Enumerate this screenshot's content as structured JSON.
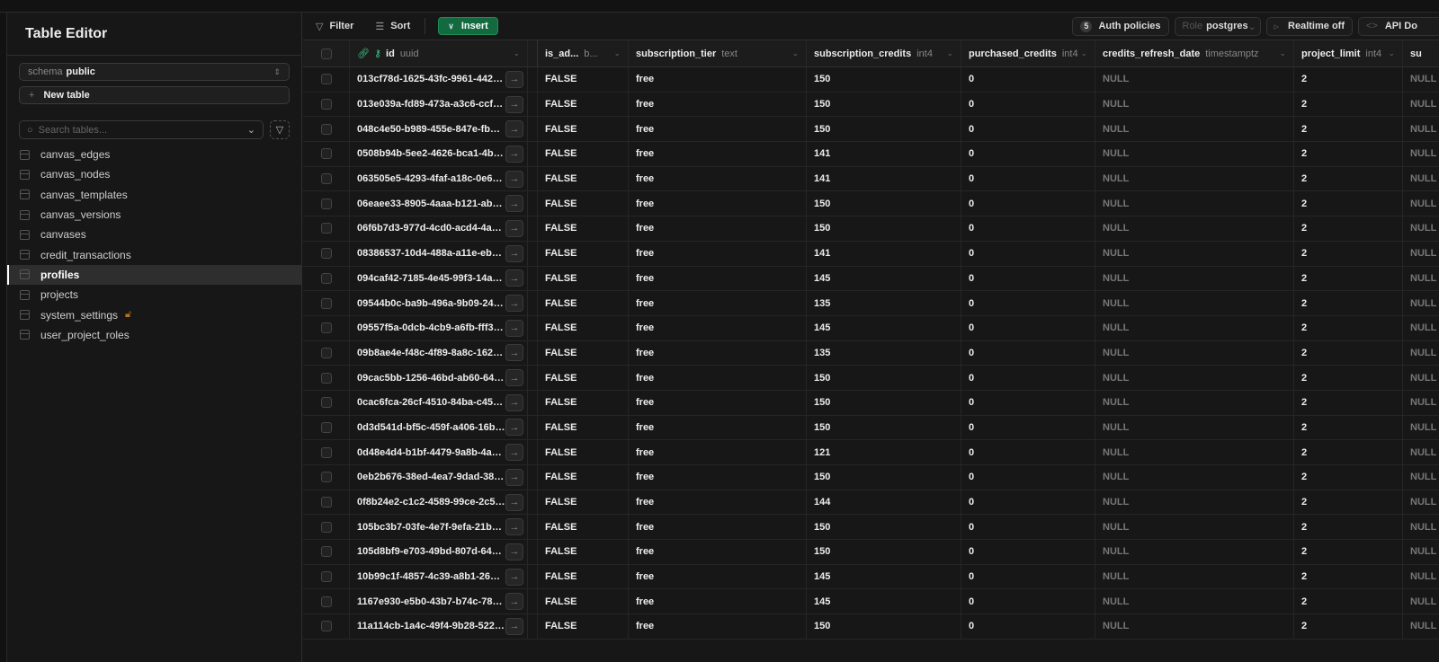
{
  "sidebar": {
    "title": "Table Editor",
    "schema_label": "schema",
    "schema_value": "public",
    "new_table": "New table",
    "search_placeholder": "Search tables...",
    "tables": [
      {
        "name": "canvas_edges"
      },
      {
        "name": "canvas_nodes"
      },
      {
        "name": "canvas_templates"
      },
      {
        "name": "canvas_versions"
      },
      {
        "name": "canvases"
      },
      {
        "name": "credit_transactions"
      },
      {
        "name": "profiles",
        "active": true
      },
      {
        "name": "projects"
      },
      {
        "name": "system_settings",
        "locked": true
      },
      {
        "name": "user_project_roles"
      }
    ]
  },
  "toolbar": {
    "filter": "Filter",
    "sort": "Sort",
    "insert": "Insert",
    "auth_count": "5",
    "auth_policies": "Auth policies",
    "role_label": "Role",
    "role_value": "postgres",
    "realtime": "Realtime off",
    "api_docs": "API Do"
  },
  "colors": {
    "accent": "#3ecf8e",
    "insert_bg": "#126a3e",
    "lock": "#b5731d"
  },
  "columns": [
    {
      "name": "id",
      "type": "uuid"
    },
    {
      "name": "is_ad...",
      "type": "b..."
    },
    {
      "name": "subscription_tier",
      "type": "text"
    },
    {
      "name": "subscription_credits",
      "type": "int4"
    },
    {
      "name": "purchased_credits",
      "type": "int4"
    },
    {
      "name": "credits_refresh_date",
      "type": "timestamptz"
    },
    {
      "name": "project_limit",
      "type": "int4"
    },
    {
      "name": "su",
      "type": ""
    }
  ],
  "rows": [
    [
      "013cf78d-1625-43fc-9961-442189...",
      "FALSE",
      "free",
      "150",
      "0",
      "NULL",
      "2",
      "NULL"
    ],
    [
      "013e039a-fd89-473a-a3c6-ccfa9...",
      "FALSE",
      "free",
      "150",
      "0",
      "NULL",
      "2",
      "NULL"
    ],
    [
      "048c4e50-b989-455e-847e-fb2f...",
      "FALSE",
      "free",
      "150",
      "0",
      "NULL",
      "2",
      "NULL"
    ],
    [
      "0508b94b-5ee2-4626-bca1-4bca...",
      "FALSE",
      "free",
      "141",
      "0",
      "NULL",
      "2",
      "NULL"
    ],
    [
      "063505e5-4293-4faf-a18c-0e65b...",
      "FALSE",
      "free",
      "141",
      "0",
      "NULL",
      "2",
      "NULL"
    ],
    [
      "06eaee33-8905-4aaa-b121-ab552...",
      "FALSE",
      "free",
      "150",
      "0",
      "NULL",
      "2",
      "NULL"
    ],
    [
      "06f6b7d3-977d-4cd0-acd4-4a78...",
      "FALSE",
      "free",
      "150",
      "0",
      "NULL",
      "2",
      "NULL"
    ],
    [
      "08386537-10d4-488a-a11e-eb5a6...",
      "FALSE",
      "free",
      "141",
      "0",
      "NULL",
      "2",
      "NULL"
    ],
    [
      "094caf42-7185-4e45-99f3-14abee...",
      "FALSE",
      "free",
      "145",
      "0",
      "NULL",
      "2",
      "NULL"
    ],
    [
      "09544b0c-ba9b-496a-9b09-244...",
      "FALSE",
      "free",
      "135",
      "0",
      "NULL",
      "2",
      "NULL"
    ],
    [
      "09557f5a-0dcb-4cb9-a6fb-fff366...",
      "FALSE",
      "free",
      "145",
      "0",
      "NULL",
      "2",
      "NULL"
    ],
    [
      "09b8ae4e-f48c-4f89-8a8c-1629b...",
      "FALSE",
      "free",
      "135",
      "0",
      "NULL",
      "2",
      "NULL"
    ],
    [
      "09cac5bb-1256-46bd-ab60-64ed...",
      "FALSE",
      "free",
      "150",
      "0",
      "NULL",
      "2",
      "NULL"
    ],
    [
      "0cac6fca-26cf-4510-84ba-c4580...",
      "FALSE",
      "free",
      "150",
      "0",
      "NULL",
      "2",
      "NULL"
    ],
    [
      "0d3d541d-bf5c-459f-a406-16b93...",
      "FALSE",
      "free",
      "150",
      "0",
      "NULL",
      "2",
      "NULL"
    ],
    [
      "0d48e4d4-b1bf-4479-9a8b-4a4b...",
      "FALSE",
      "free",
      "121",
      "0",
      "NULL",
      "2",
      "NULL"
    ],
    [
      "0eb2b676-38ed-4ea7-9dad-38e6...",
      "FALSE",
      "free",
      "150",
      "0",
      "NULL",
      "2",
      "NULL"
    ],
    [
      "0f8b24e2-c1c2-4589-99ce-2c52d...",
      "FALSE",
      "free",
      "144",
      "0",
      "NULL",
      "2",
      "NULL"
    ],
    [
      "105bc3b7-03fe-4e7f-9efa-21bb40...",
      "FALSE",
      "free",
      "150",
      "0",
      "NULL",
      "2",
      "NULL"
    ],
    [
      "105d8bf9-e703-49bd-807d-645e...",
      "FALSE",
      "free",
      "150",
      "0",
      "NULL",
      "2",
      "NULL"
    ],
    [
      "10b99c1f-4857-4c39-a8b1-263b8...",
      "FALSE",
      "free",
      "145",
      "0",
      "NULL",
      "2",
      "NULL"
    ],
    [
      "1167e930-e5b0-43b7-b74c-788c9...",
      "FALSE",
      "free",
      "145",
      "0",
      "NULL",
      "2",
      "NULL"
    ],
    [
      "11a114cb-1a4c-49f4-9b28-52219ec...",
      "FALSE",
      "free",
      "150",
      "0",
      "NULL",
      "2",
      "NULL"
    ]
  ]
}
